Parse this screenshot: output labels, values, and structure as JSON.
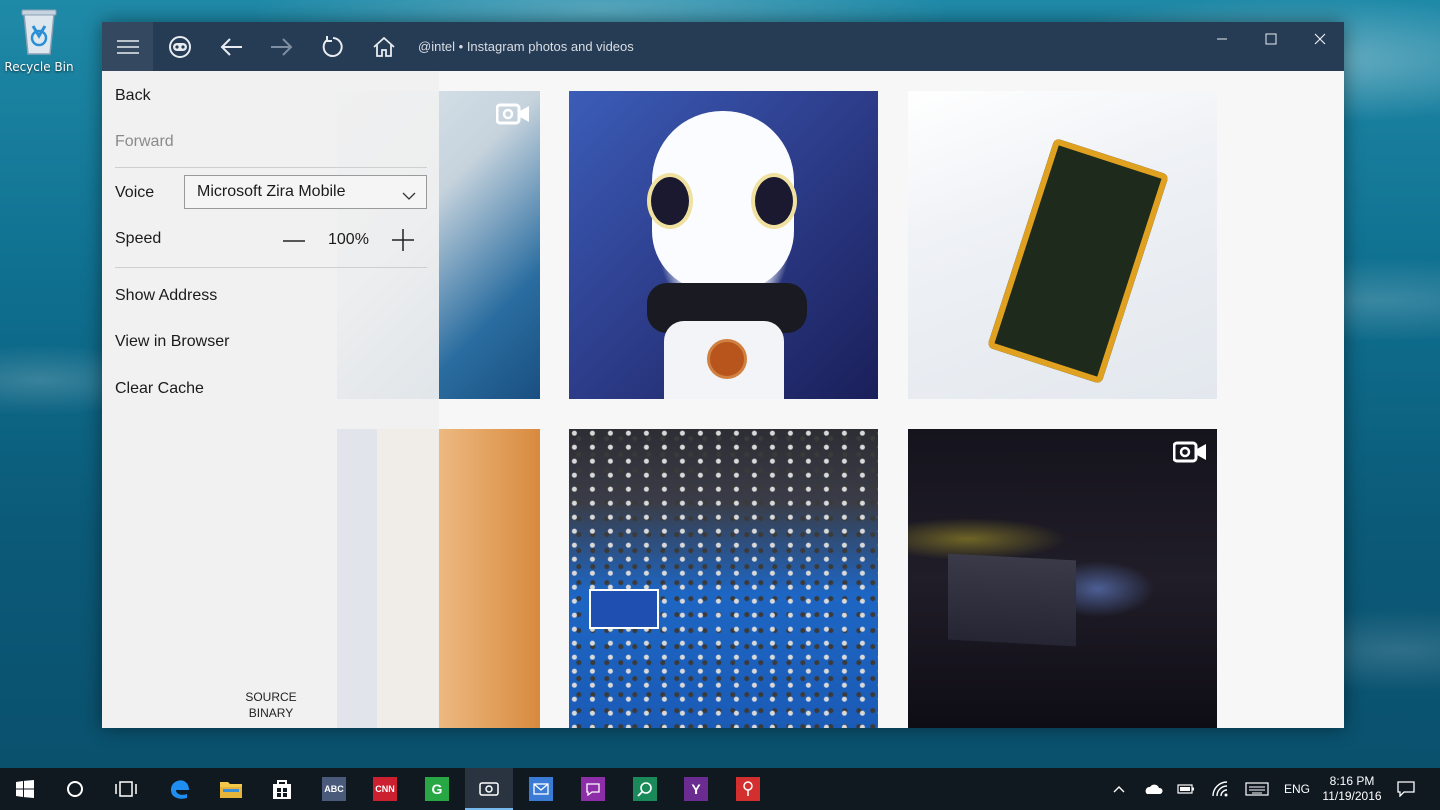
{
  "desktop": {
    "recycle_bin_label": "Recycle Bin"
  },
  "window": {
    "title": "@intel • Instagram photos and videos",
    "titlebar_color": "#263b54"
  },
  "menu": {
    "back_label": "Back",
    "forward_label": "Forward",
    "voice_label": "Voice",
    "voice_value": "Microsoft Zira Mobile",
    "speed_label": "Speed",
    "speed_value": "100%",
    "show_address_label": "Show Address",
    "view_in_browser_label": "View in Browser",
    "clear_cache_label": "Clear Cache",
    "source_line1": "SOURCE",
    "source_line2": "BINARY"
  },
  "taskbar": {
    "apps": [
      {
        "name": "ABC",
        "color": "#4a5a7a"
      },
      {
        "name": "CNN",
        "color": "#cc1f2f"
      },
      {
        "name": "G",
        "color": "#27a844"
      },
      {
        "name": "Y",
        "color": "#6a2c91"
      }
    ],
    "language": "ENG",
    "time": "8:16 PM",
    "date": "11/19/2016"
  }
}
